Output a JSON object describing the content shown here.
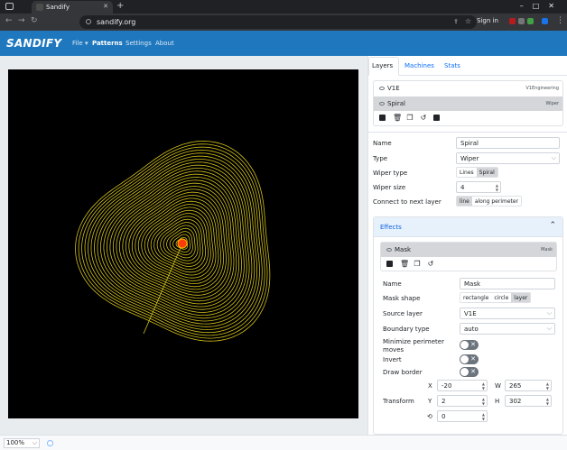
{
  "browser": {
    "tab_title": "Sandify",
    "url": "sandify.org",
    "signin_label": "Sign in",
    "new_tab": "+",
    "close": "✕"
  },
  "navbar": {
    "logo": "SANDIFY",
    "items": [
      {
        "label": "File ▾"
      },
      {
        "label": "Patterns"
      },
      {
        "label": "Settings"
      },
      {
        "label": "About"
      }
    ]
  },
  "panel": {
    "tabs": [
      "Layers",
      "Machines",
      "Stats"
    ],
    "layers": [
      {
        "name": "V1E",
        "type": "V1Engineering"
      },
      {
        "name": "Spiral",
        "type": "Wiper"
      }
    ],
    "props": {
      "name_label": "Name",
      "name_value": "Spiral",
      "type_label": "Type",
      "type_value": "Wiper",
      "wiper_type_label": "Wiper type",
      "wiper_type_options": [
        "Lines",
        "Spiral"
      ],
      "wiper_size_label": "Wiper size",
      "wiper_size_value": "4",
      "connect_label": "Connect to next layer",
      "connect_options": [
        "line",
        "along perimeter"
      ]
    },
    "effects": {
      "title": "Effects",
      "mask_name": "Mask",
      "mask_type": "Mask",
      "name_label": "Name",
      "name_value": "Mask",
      "shape_label": "Mask shape",
      "shape_options": [
        "rectangle",
        "circle",
        "layer"
      ],
      "source_label": "Source layer",
      "source_value": "V1E",
      "boundary_label": "Boundary type",
      "boundary_value": "auto",
      "minimize_label": "Minimize perimeter moves",
      "invert_label": "Invert",
      "border_label": "Draw border",
      "transform_label": "Transform",
      "x_label": "X",
      "x_value": "-20",
      "y_label": "Y",
      "y_value": "2",
      "w_label": "W",
      "w_value": "265",
      "h_label": "H",
      "h_value": "302",
      "rotation_value": "0"
    }
  },
  "footer": {
    "zoom": "100%"
  },
  "colors": {
    "navbar": "#1f78be",
    "spiral": "#d4c21a",
    "start_dot": "#ff3b0a"
  }
}
